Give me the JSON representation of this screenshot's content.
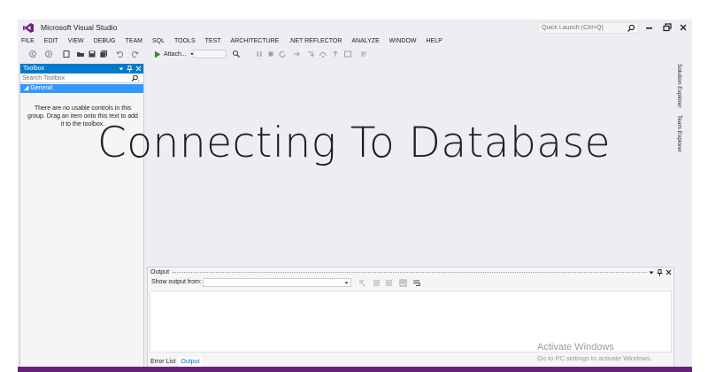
{
  "app": {
    "title": "Microsoft Visual Studio",
    "logo_icon": "visual-studio-logo",
    "accent_color": "#007acc",
    "status_color": "#68217a"
  },
  "quick_launch": {
    "placeholder": "Quick Launch (Ctrl+Q)"
  },
  "menu": {
    "items": [
      "FILE",
      "EDIT",
      "VIEW",
      "DEBUG",
      "TEAM",
      "SQL",
      "TOOLS",
      "TEST",
      "ARCHITECTURE",
      ".NET REFLECTOR",
      "ANALYZE",
      "WINDOW",
      "HELP"
    ]
  },
  "toolbar": {
    "attach_label": "Attach..."
  },
  "toolbox": {
    "title": "Toolbox",
    "search_placeholder": "Search Toolbox",
    "group": "General",
    "empty_message": "There are no usable controls in this group. Drag an item onto this text to add it to the toolbox."
  },
  "side_tabs": {
    "solution_explorer": "Solution Explorer",
    "team_explorer": "Team Explorer"
  },
  "output": {
    "title": "Output",
    "show_output_label": "Show output from:",
    "tabs": [
      "Error List",
      "Output"
    ]
  },
  "overlay": {
    "title": "Connecting To Database"
  },
  "watermark": {
    "title": "Activate Windows",
    "subtitle": "Go to PC settings to activate Windows."
  }
}
